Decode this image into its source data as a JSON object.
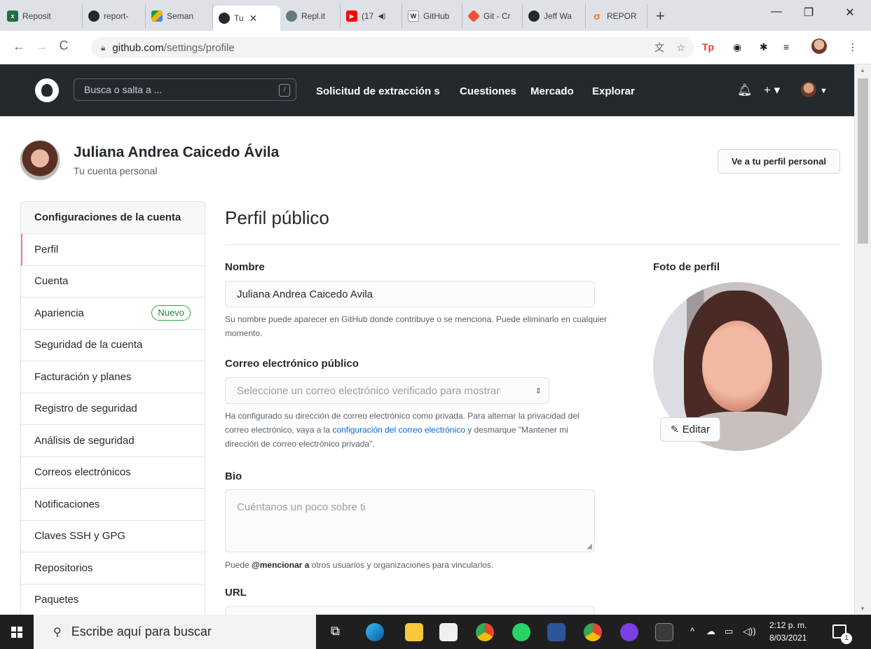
{
  "browser": {
    "tabs": [
      {
        "label": "Reposit",
        "icon": "excel-icon",
        "color": "#1d6f42"
      },
      {
        "label": "report-",
        "icon": "github-icon",
        "color": "#24292e"
      },
      {
        "label": "Seman",
        "icon": "google-drive-icon",
        "color": "#f4b400"
      },
      {
        "label": "Tu",
        "icon": "github-icon",
        "color": "#24292e"
      },
      {
        "label": "Repl.it",
        "icon": "replit-icon",
        "color": "#667881"
      },
      {
        "label": "(17",
        "icon": "youtube-icon",
        "color": "#ff0000"
      },
      {
        "label": "GitHub",
        "icon": "wikipedia-icon",
        "color": "#444444"
      },
      {
        "label": "Git - Cr",
        "icon": "git-icon",
        "color": "#f05033"
      },
      {
        "label": "Jeff Wa",
        "icon": "github-icon",
        "color": "#24292e"
      },
      {
        "label": "REPOR",
        "icon": "sigma-icon",
        "color": "#ff6f00"
      }
    ],
    "url_host": "github.com",
    "url_path": "/settings/profile"
  },
  "github_header": {
    "search_placeholder": "Busca o salta a ...",
    "search_key": "/",
    "nav": [
      "Solicitud de extracción s",
      "Cuestiones",
      "Mercado",
      "Explorar"
    ]
  },
  "user": {
    "name": "Juliana Andrea Caicedo Ávila",
    "subtitle": "Tu cuenta personal",
    "profile_button": "Ve a tu perfil personal"
  },
  "sidebar": {
    "heading": "Configuraciones de la cuenta",
    "items": [
      {
        "label": "Perfil"
      },
      {
        "label": "Cuenta"
      },
      {
        "label": "Apariencia",
        "badge": "Nuevo"
      },
      {
        "label": "Seguridad de la cuenta"
      },
      {
        "label": "Facturación y planes"
      },
      {
        "label": "Registro de seguridad"
      },
      {
        "label": "Análisis de seguridad"
      },
      {
        "label": "Correos electrónicos"
      },
      {
        "label": "Notificaciones"
      },
      {
        "label": "Claves SSH y GPG"
      },
      {
        "label": "Repositorios"
      },
      {
        "label": "Paquetes"
      }
    ]
  },
  "main": {
    "title": "Perfil público",
    "name_label": "Nombre",
    "name_value": "Juliana Andrea Caicedo Avila",
    "name_note": "Su nombre puede aparecer en GitHub donde contribuye o se menciona. Puede eliminarlo en cualquier momento.",
    "email_label": "Correo electrónico público",
    "email_select": "Seleccione un correo electrónico verificado para mostrar",
    "email_note_1": "Ha configurado su dirección de correo electrónico como privada. Para alternar la privacidad del correo electrónico, vaya a la",
    "email_note_link": "configuración del correo electrónico",
    "email_note_2": "y desmarque \"Mantener mi dirección de correo electrónico privada\".",
    "bio_label": "Bio",
    "bio_placeholder": "Cuéntanos un poco sobre ti",
    "bio_note_1": "Puede",
    "bio_note_strong": "@mencionar a",
    "bio_note_2": "otros usuarios y organizaciones para vincularlos.",
    "url_label": "URL",
    "photo_label": "Foto de perfil",
    "edit_button": "Editar"
  },
  "taskbar": {
    "search_placeholder": "Escribe aquí para buscar",
    "time": "2:12 p. m.",
    "date": "8/03/2021",
    "notifications": "1"
  }
}
